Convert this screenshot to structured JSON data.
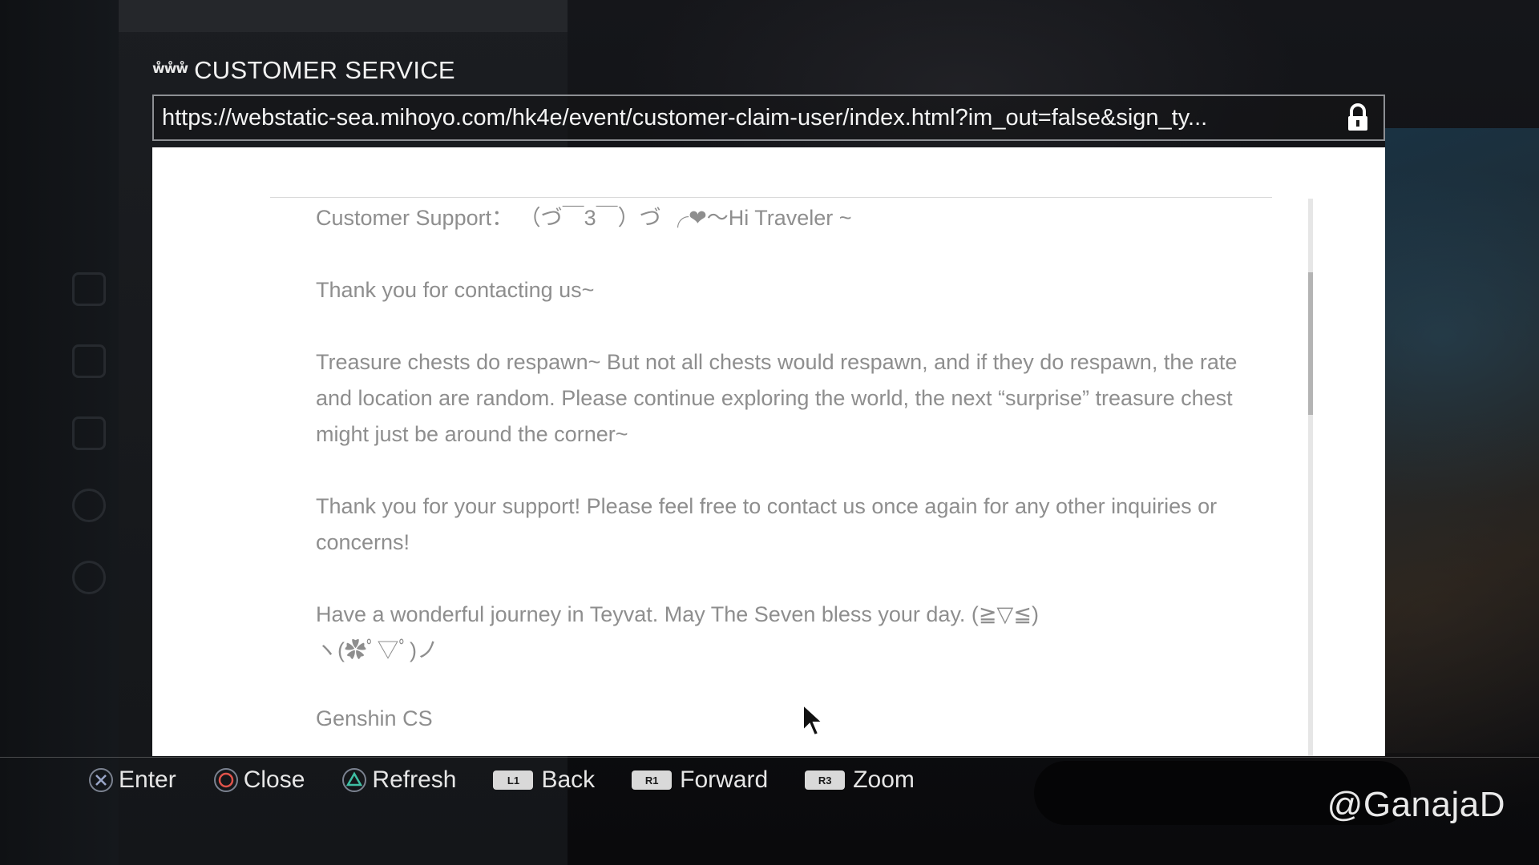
{
  "window": {
    "title": "CUSTOMER SERVICE",
    "icon": "www-icon"
  },
  "address_bar": {
    "url": "https://webstatic-sea.mihoyo.com/hk4e/event/customer-claim-user/index.html?im_out=false&sign_ty...",
    "secure": true,
    "icon": "lock-icon"
  },
  "message": {
    "greeting": "Customer Support： （づ￣3￣）づ ╭❤～Hi Traveler ~",
    "thanks": "Thank you for contacting us~",
    "body_1": "Treasure chests do respawn~ But not all chests would respawn, and if they do respawn, the rate and location are random. Please continue exploring the world, the next “surprise” treasure chest might just be around the corner~",
    "body_2": "Thank you for your support! Please feel free to contact us once again for any other inquiries or concerns!",
    "farewell": "Have a wonderful journey in Teyvat. May The Seven bless your day. (≧▽≦)",
    "emoticon": "ヽ(✿ﾟ▽ﾟ)ノ",
    "signature": "Genshin CS"
  },
  "controls": [
    {
      "button": "cross",
      "label": "Enter"
    },
    {
      "button": "circle",
      "label": "Close"
    },
    {
      "button": "triangle",
      "label": "Refresh"
    },
    {
      "button": "L1",
      "label": "Back"
    },
    {
      "button": "R1",
      "label": "Forward"
    },
    {
      "button": "R3",
      "label": "Zoom"
    }
  ],
  "watermark": "@GanajaD",
  "colors": {
    "cross": "#9aa6c8",
    "circle": "#e0534a",
    "triangle": "#3fbfa4",
    "page_text": "#8e8e8e"
  }
}
